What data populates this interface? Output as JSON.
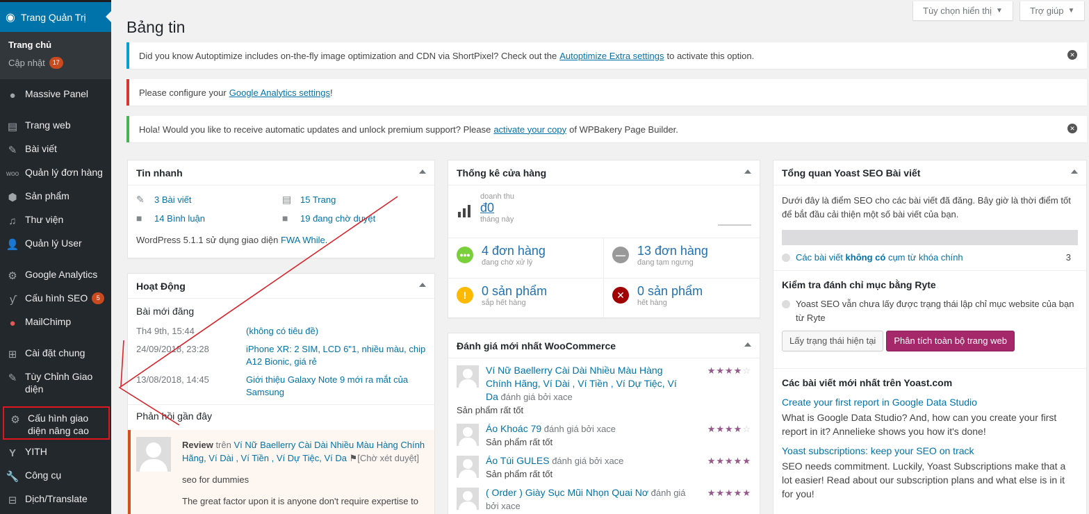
{
  "sidebar": {
    "header": {
      "label": "Trang Quản Trị"
    },
    "sub_items": [
      {
        "label": "Trang chủ"
      },
      {
        "label": "Cập nhật",
        "badge": "17"
      }
    ],
    "items": [
      {
        "label": "Massive Panel"
      },
      {
        "label": "Trang web"
      },
      {
        "label": "Bài viết"
      },
      {
        "label": "Quản lý đơn hàng"
      },
      {
        "label": "Sản phẩm"
      },
      {
        "label": "Thư viện"
      },
      {
        "label": "Quản lý User"
      },
      {
        "label": "Google Analytics"
      },
      {
        "label": "Cấu hình SEO",
        "badge": "5"
      },
      {
        "label": "MailChimp"
      },
      {
        "label": "Cài đặt chung"
      },
      {
        "label": "Tùy Chỉnh Giao diện"
      },
      {
        "label": "Cấu hình giao diện nâng cao"
      },
      {
        "label": "YITH"
      },
      {
        "label": "Công cụ"
      },
      {
        "label": "Dịch/Translate"
      }
    ]
  },
  "top": {
    "screen_options": "Tùy chọn hiển thị",
    "help": "Trợ giúp"
  },
  "page_title": "Bảng tin",
  "notices": [
    {
      "pre": "Did you know Autoptimize includes on-the-fly image optimization and CDN via ShortPixel? Check out the",
      "link": "Autoptimize Extra settings",
      "post": "to activate this option."
    },
    {
      "pre": "Please configure your",
      "link": "Google Analytics settings",
      "post": "!"
    },
    {
      "pre": "Hola! Would you like to receive automatic updates and unlock premium support? Please",
      "link": "activate your copy",
      "post": "of WPBakery Page Builder."
    }
  ],
  "glance": {
    "title": "Tin nhanh",
    "posts": "3 Bài viết",
    "pages": "15 Trang",
    "comments": "14 Bình luận",
    "pending": "19 đang chờ duyệt",
    "wp_pre": "WordPress 5.1.1 sử dụng giao diện",
    "theme": "FWA While",
    "wp_post": "."
  },
  "activity": {
    "title": "Hoạt Động",
    "recent_title": "Bài mới đăng",
    "posts": [
      {
        "date": "Th4 9th, 15:44",
        "title": "(không có tiêu đề)"
      },
      {
        "date": "24/09/2018, 23:28",
        "title": "iPhone XR: 2 SIM, LCD 6\"1, nhiều màu, chip A12 Bionic, giá rẻ"
      },
      {
        "date": "13/08/2018, 14:45",
        "title": "Giới thiệu Galaxy Note 9 mới ra mắt của Samsung"
      }
    ],
    "comments_title": "Phản hồi gần đây",
    "comment": {
      "type": "Review",
      "on": "trên",
      "post": "Ví Nữ Baellerry Cài Dài Nhiều Màu Hàng Chính Hãng, Ví Dài , Ví Tiền , Ví Dự Tiệc, Ví Da",
      "status": "[Chờ xét duyệt]",
      "author": "seo for dummies",
      "text": "The great factor upon it is anyone don't require expertise to"
    }
  },
  "woo_status": {
    "title": "Thống kê cửa hàng",
    "revenue_label": "doanh thu",
    "revenue": "đ0",
    "period": "tháng này",
    "cells": [
      {
        "value": "4 đơn hàng",
        "label": "đang chờ xử lý",
        "color": "#7ad03a",
        "icon": "dots-icon"
      },
      {
        "value": "13 đơn hàng",
        "label": "đang tạm ngưng",
        "color": "#999999",
        "icon": "minus-icon"
      },
      {
        "value": "0 sản phẩm",
        "label": "sắp hết hàng",
        "color": "#ffba00",
        "icon": "warning-icon"
      },
      {
        "value": "0 sản phẩm",
        "label": "hết hàng",
        "color": "#a00000",
        "icon": "x-icon"
      }
    ]
  },
  "reviews": {
    "title": "Đánh giá mới nhất WooCommerce",
    "by": "đánh giá bởi",
    "items": [
      {
        "product": "Ví Nữ Baellerry Cài Dài Nhiều Màu Hàng Chính Hãng, Ví Dài , Ví Tiền , Ví Dự Tiệc, Ví Da",
        "author": "xace",
        "text": "Sản phẩm rất tốt",
        "rating": 4
      },
      {
        "product": "Áo Khoác 79",
        "author": "xace",
        "text": "Sản phẩm rất tốt",
        "rating": 4
      },
      {
        "product": "Áo Túi GULES",
        "author": "xace",
        "text": "Sản phẩm rất tốt",
        "rating": 5
      },
      {
        "product": "( Order ) Giày Sục Mũi Nhọn Quai Nơ",
        "author": "xace",
        "text": "",
        "rating": 5
      }
    ]
  },
  "yoast": {
    "title": "Tổng quan Yoast SEO Bài viết",
    "intro": "Dưới đây là điểm SEO cho các bài viết đã đăng. Bây giờ là thời điểm tốt để bắt đầu cải thiện một số bài viết của bạn.",
    "no_kw_pre": "Các bài viết",
    "no_kw_bold": "không có",
    "no_kw_post": "cụm từ khóa chính",
    "no_kw_count": "3",
    "ryte_title": "Kiểm tra đánh chỉ mục bằng Ryte",
    "ryte_text": "Yoast SEO vẫn chưa lấy được trạng thái lập chỉ mục website của bạn từ Ryte",
    "btn_fetch": "Lấy trạng thái hiện tại",
    "btn_analyze": "Phân tích toàn bộ trang web",
    "news_title": "Các bài viết mới nhất trên Yoast.com",
    "news": [
      {
        "title": "Create your first report in Google Data Studio",
        "text": "What is Google Data Studio? And, how can you create your first report in it? Annelieke shows you how it's done!"
      },
      {
        "title": "Yoast subscriptions: keep your SEO on track",
        "text": "SEO needs commitment. Luckily, Yoast Subscriptions make that a lot easier! Read about our subscription plans and what else is in it for you!"
      }
    ]
  },
  "colors": {
    "sidebar_bg": "#23282d",
    "accent": "#0073aa",
    "annotation": "#e0161e"
  }
}
